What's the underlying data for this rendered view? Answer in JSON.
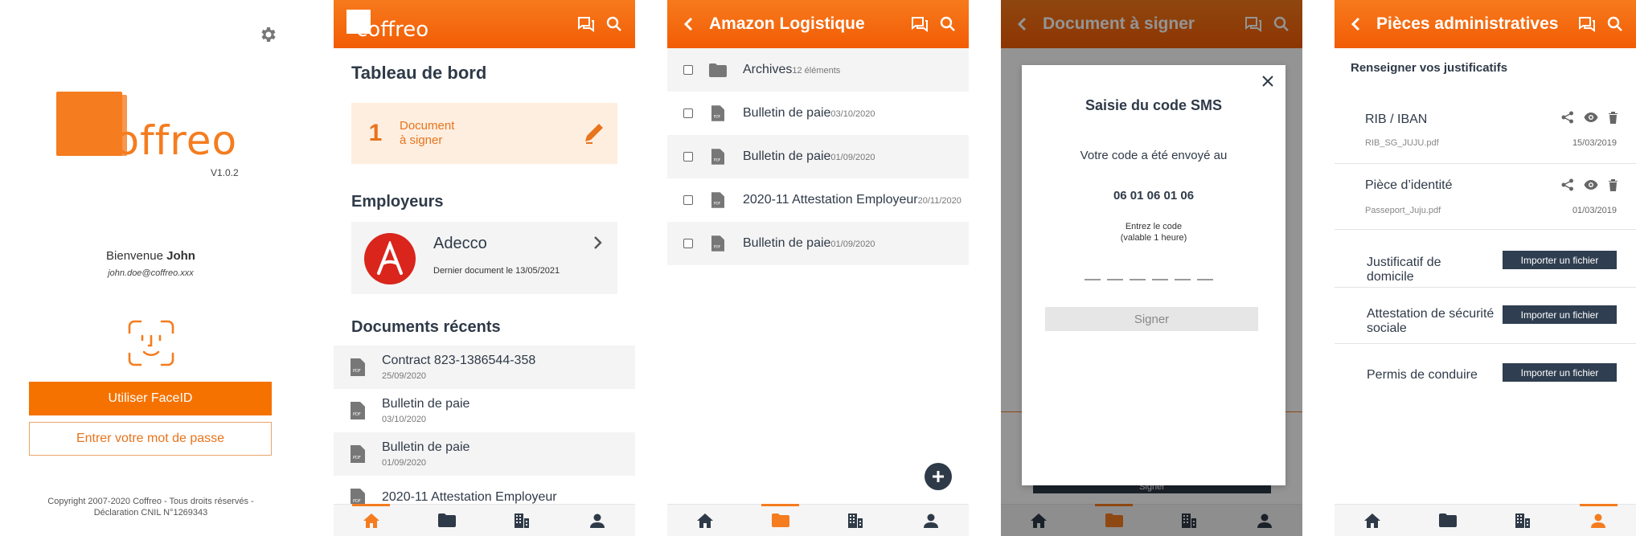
{
  "colors": {
    "brand_orange": "#f57c1f",
    "header_gradient_start": "#f77a1c",
    "header_gradient_end": "#f25c05",
    "navy": "#2f3a48",
    "adecco_red": "#d9251c"
  },
  "login": {
    "logo_text": "coffreo",
    "version": "V1.0.2",
    "welcome_prefix": "Bienvenue",
    "user_name": "John",
    "email": "john.doe@coffreo.xxx",
    "faceid_button": "Utiliser FaceID",
    "password_button": "Entrer votre mot de passe",
    "copyright_line1": "Copyright 2007-2020 Coffreo - Tous droits réservés -",
    "copyright_line2": "Déclaration CNIL N°1269343",
    "icons": [
      "gear-icon",
      "faceid-icon"
    ]
  },
  "dashboard": {
    "header_logo": "coffreo",
    "title": "Tableau de bord",
    "pending": {
      "count": "1",
      "label_line1": "Document",
      "label_line2": "à signer"
    },
    "employers_title": "Employeurs",
    "employer": {
      "name": "Adecco",
      "subtitle": "Dernier document le 13/05/2021"
    },
    "recent_title": "Documents récents",
    "recent_docs": [
      {
        "title": "Contract 823-1386544-358",
        "date": "25/09/2020"
      },
      {
        "title": "Bulletin de paie",
        "date": "03/10/2020"
      },
      {
        "title": "Bulletin de paie",
        "date": "01/09/2020"
      },
      {
        "title": "2020-11 Attestation Employeur",
        "date": ""
      }
    ]
  },
  "folder": {
    "title": "Amazon Logistique",
    "items": [
      {
        "title": "Archives",
        "date": "12 éléments",
        "type": "folder"
      },
      {
        "title": "Bulletin de paie",
        "date": "03/10/2020",
        "type": "pdf"
      },
      {
        "title": "Bulletin de paie",
        "date": "01/09/2020",
        "type": "pdf"
      },
      {
        "title": "2020-11 Attestation Employeur",
        "date": "20/11/2020",
        "type": "pdf"
      },
      {
        "title": "Bulletin de paie",
        "date": "01/09/2020",
        "type": "pdf"
      }
    ]
  },
  "sign": {
    "title": "Document à signer",
    "modal_title": "Saisie du code SMS",
    "line1": "Votre code a été envoyé au",
    "phone": "06 01 06 01 06",
    "hint_line1": "Entrez le code",
    "hint_line2": "(valable 1 heure)",
    "sign_button": "Signer",
    "bg_button": "Signer"
  },
  "admin": {
    "title": "Pièces administratives",
    "subhead": "Renseigner vos justificatifs",
    "filled": [
      {
        "label": "RIB / IBAN",
        "file": "RIB_SG_JUJU.pdf",
        "date": "15/03/2019"
      },
      {
        "label": "Pièce d’identité",
        "file": "Passeport_Juju.pdf",
        "date": "01/03/2019"
      }
    ],
    "empty": [
      {
        "label_line1": "Justificatif de",
        "label_line2": "domicile",
        "button": "Importer un fichier"
      },
      {
        "label_line1": "Attestation de sécurité",
        "label_line2": "sociale",
        "button": "Importer un fichier"
      },
      {
        "label_line1": "Permis de conduire",
        "label_line2": "",
        "button": "Importer un fichier"
      }
    ]
  },
  "tabbar": {
    "tabs": [
      "home-icon",
      "folder-icon",
      "building-icon",
      "user-icon"
    ]
  }
}
